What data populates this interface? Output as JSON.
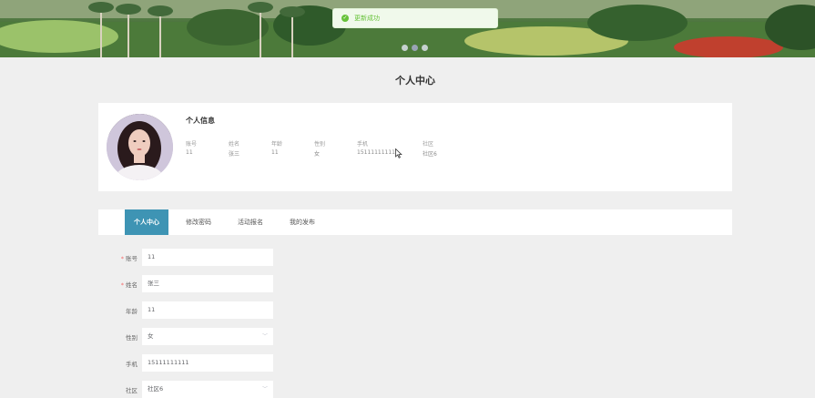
{
  "toast": {
    "text": "更新成功",
    "icon": "success-check-icon",
    "color": "#67c23a"
  },
  "banner": {
    "slide_count": 3,
    "active_slide": 2
  },
  "page": {
    "title": "个人中心"
  },
  "info": {
    "title": "个人信息",
    "fields": [
      {
        "label": "账号",
        "value": "11"
      },
      {
        "label": "姓名",
        "value": "张三"
      },
      {
        "label": "年龄",
        "value": "11"
      },
      {
        "label": "性别",
        "value": "女"
      },
      {
        "label": "手机",
        "value": "15111111111"
      },
      {
        "label": "社区",
        "value": "社区6"
      }
    ]
  },
  "tabs": [
    {
      "label": "个人中心",
      "active": true
    },
    {
      "label": "修改密码",
      "active": false
    },
    {
      "label": "活动报名",
      "active": false
    },
    {
      "label": "我的发布",
      "active": false
    }
  ],
  "form": {
    "account": {
      "label": "账号",
      "value": "11",
      "required": "*"
    },
    "name": {
      "label": "姓名",
      "value": "张三",
      "required": "*"
    },
    "age": {
      "label": "年龄",
      "value": "11"
    },
    "gender": {
      "label": "性别",
      "value": "女"
    },
    "phone": {
      "label": "手机",
      "value": "15111111111"
    },
    "community": {
      "label": "社区",
      "value": "社区6"
    }
  },
  "colors": {
    "accent": "#3e94b4",
    "success": "#67c23a",
    "background": "#efefef"
  }
}
